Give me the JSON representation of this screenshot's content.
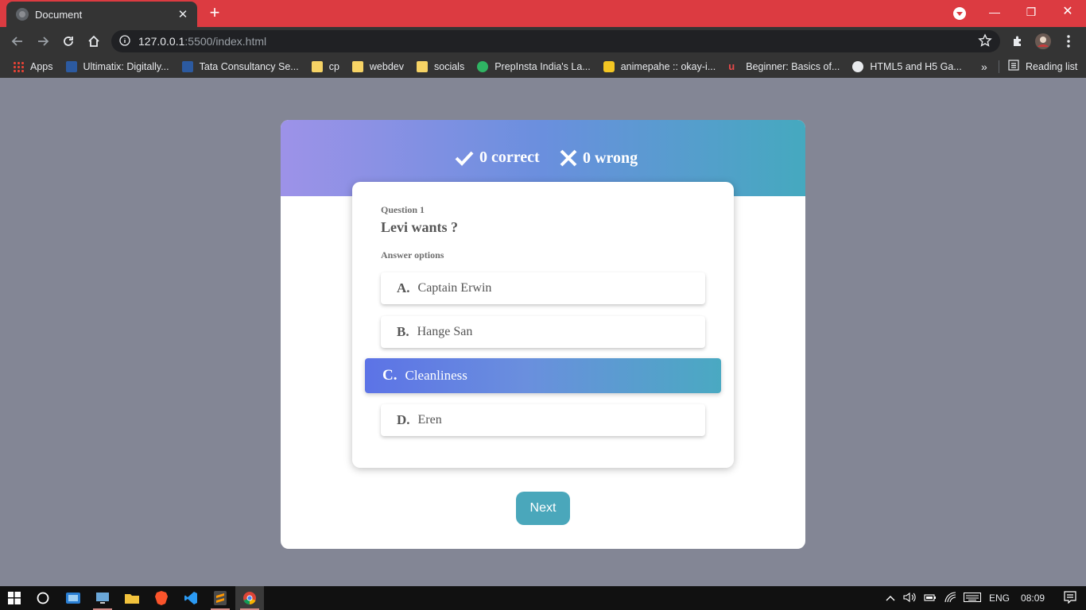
{
  "browser": {
    "tab_title": "Document",
    "close_glyph": "✕",
    "new_tab_glyph": "+",
    "url_host": "127.0.0.1",
    "url_path": ":5500/index.html",
    "window_controls": {
      "minimize": "—",
      "restore": "❐",
      "close": "✕"
    },
    "accent_color": "#dc3b41"
  },
  "bookmarks": {
    "items": [
      {
        "label": "Apps",
        "icon": "apps-grid-icon"
      },
      {
        "label": "Ultimatix: Digitally...",
        "icon": "tata-icon"
      },
      {
        "label": "Tata Consultancy Se...",
        "icon": "tata-icon"
      },
      {
        "label": "cp",
        "icon": "folder-icon"
      },
      {
        "label": "webdev",
        "icon": "folder-icon"
      },
      {
        "label": "socials",
        "icon": "folder-icon"
      },
      {
        "label": "PrepInsta India's La...",
        "icon": "prepinsta-icon"
      },
      {
        "label": "animepahe :: okay-i...",
        "icon": "animepahe-icon"
      },
      {
        "label": "Beginner: Basics of...",
        "icon": "udemy-icon"
      },
      {
        "label": "HTML5 and H5 Ga...",
        "icon": "globe-icon"
      }
    ],
    "more": "»",
    "reading_list": "Reading list"
  },
  "quiz": {
    "correct_label": "0 correct",
    "wrong_label": "0 wrong",
    "question_number": "Question 1",
    "question_text": "Levi wants ?",
    "answer_options_label": "Answer options",
    "options": [
      {
        "letter": "A.",
        "text": "Captain Erwin",
        "selected": false
      },
      {
        "letter": "B.",
        "text": "Hange San",
        "selected": false
      },
      {
        "letter": "C.",
        "text": "Cleanliness",
        "selected": true
      },
      {
        "letter": "D.",
        "text": "Eren",
        "selected": false
      }
    ],
    "next_label": "Next",
    "colors": {
      "gradient_start": "#9d92e8",
      "gradient_mid": "#6a8fde",
      "gradient_end": "#45a9bf",
      "next_button": "#4aa7bb"
    }
  },
  "taskbar": {
    "language": "ENG",
    "time": "08:09",
    "apps": [
      "windows-start-icon",
      "cortana-icon",
      "app-icon",
      "remote-desktop-icon",
      "file-explorer-icon",
      "brave-icon",
      "vscode-icon",
      "sublime-icon",
      "chrome-icon"
    ]
  }
}
